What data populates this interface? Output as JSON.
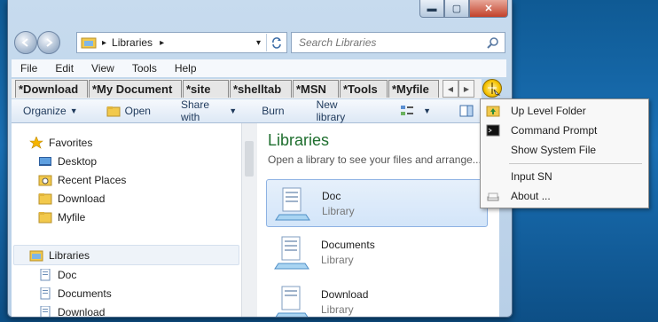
{
  "window": {
    "minimize": "▬",
    "maximize": "▢",
    "close": "✕"
  },
  "address": {
    "breadcrumb_arrow": "▸",
    "location": "Libraries",
    "dropdown_arrow": "▾"
  },
  "search": {
    "placeholder": "Search Libraries"
  },
  "menu_bar": [
    "File",
    "Edit",
    "View",
    "Tools",
    "Help"
  ],
  "tabs": [
    "*Download",
    "*My Document",
    "*site",
    "*shelltab",
    "*MSN",
    "*Tools",
    "*Myfile"
  ],
  "command_bar": {
    "organize": "Organize",
    "open": "Open",
    "share_with": "Share with",
    "burn": "Burn",
    "new_library": "New library"
  },
  "nav_pane": {
    "favorites_header": "Favorites",
    "favorites": [
      "Desktop",
      "Recent Places",
      "Download",
      "Myfile"
    ],
    "libraries_header": "Libraries",
    "libraries": [
      "Doc",
      "Documents",
      "Download"
    ]
  },
  "main": {
    "title": "Libraries",
    "subtitle": "Open a library to see your files and arrange...",
    "items": [
      {
        "name": "Doc",
        "type": "Library"
      },
      {
        "name": "Documents",
        "type": "Library"
      },
      {
        "name": "Download",
        "type": "Library"
      }
    ]
  },
  "context_menu": {
    "items": [
      "Up Level Folder",
      "Command Prompt",
      "Show System File",
      "Input SN",
      "About ..."
    ]
  },
  "colors": {
    "accent": "#1e6e2e",
    "selection": "#d3e5f9"
  }
}
